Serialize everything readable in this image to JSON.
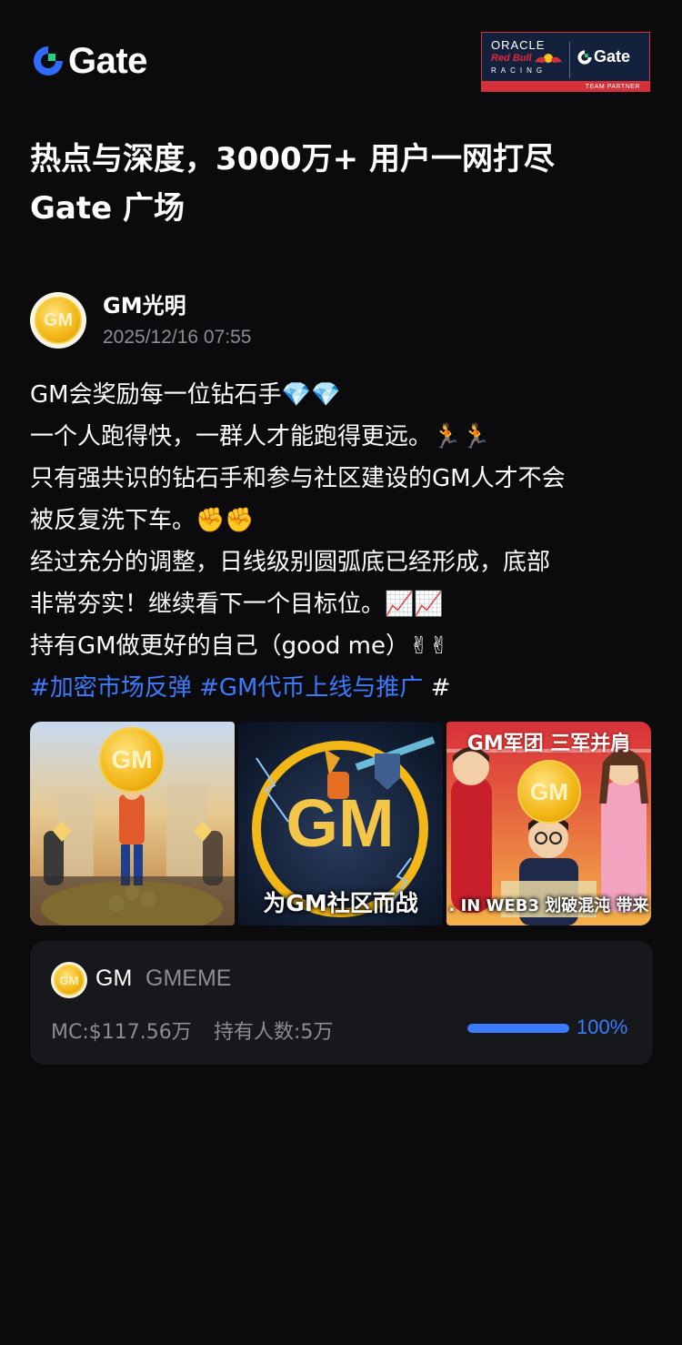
{
  "brand": {
    "logo_text": "Gate",
    "accent_color": "#3b7bff"
  },
  "partner_badge": {
    "line1": "ORACLE",
    "line2": "Red Bull",
    "line3": "RACING",
    "gate_text": "Gate",
    "footer": "TEAM PARTNER"
  },
  "headline": {
    "line1": "热点与深度，3000万+ 用户一网打尽",
    "line2": "Gate 广场"
  },
  "post": {
    "author_name": "GM光明",
    "avatar_text": "GM",
    "timestamp": "2025/12/16 07:55",
    "lines": [
      "GM会奖励每一位钻石手💎💎",
      "一个人跑得快，一群人才能跑得更远。🏃🏃",
      "只有强共识的钻石手和参与社区建设的GM人才不会",
      "被反复洗下车。✊✊",
      "经过充分的调整，日线级别圆弧底已经形成，底部",
      "非常夯实！继续看下一个目标位。📈📈",
      "持有GM做更好的自己（good me）✌✌"
    ],
    "tags": [
      "#加密市场反弹",
      "#GM代币上线与推广"
    ],
    "trailing_hash": "#",
    "images": [
      {
        "coin_text": "GM",
        "caption": ""
      },
      {
        "coin_text": "GM",
        "caption": "为GM社区而战"
      },
      {
        "coin_text": "GM",
        "top_caption": "GM军团 三军并肩",
        "caption": ". IN WEB3 划破混沌 带来"
      }
    ]
  },
  "token": {
    "avatar_text": "GM",
    "symbol": "GM",
    "name": "GMEME",
    "market_cap": "MC:$117.56万",
    "holders": "持有人数:5万",
    "progress_percent": 100,
    "progress_label": "100%"
  }
}
